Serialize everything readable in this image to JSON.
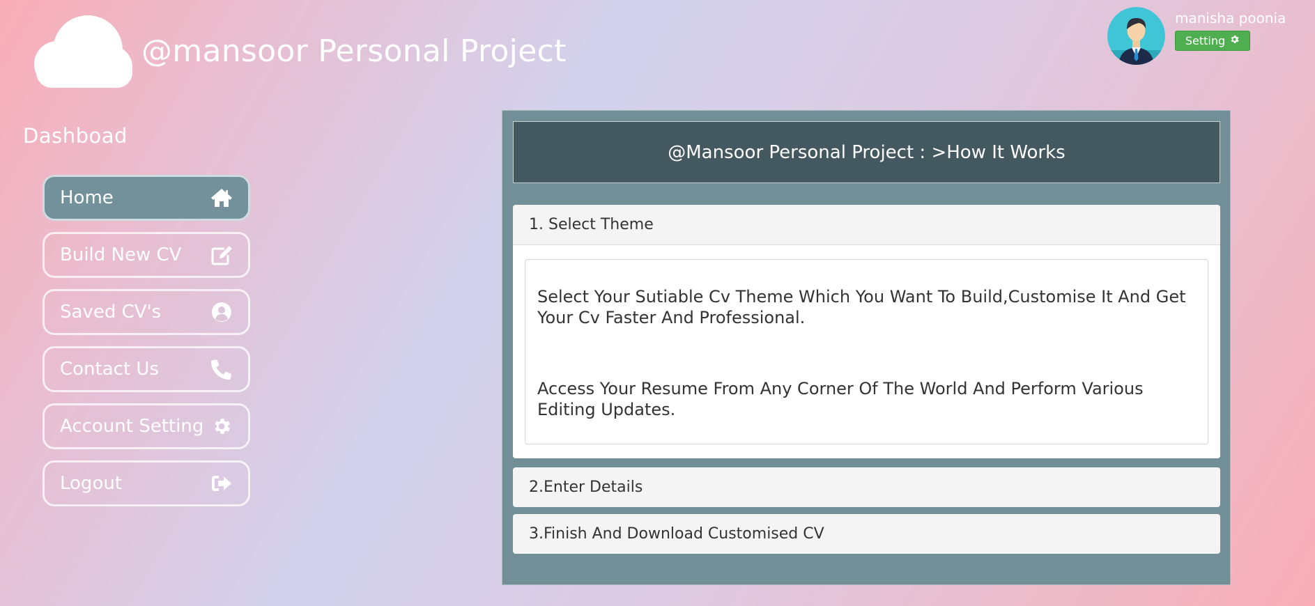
{
  "header": {
    "site_title": "@mansoor Personal Project",
    "logo_icon": "cloud-icon"
  },
  "user": {
    "name": "manisha poonia",
    "setting_label": "Setting",
    "avatar_icon": "user-avatar-icon"
  },
  "sidebar": {
    "title": "Dashboad",
    "items": [
      {
        "label": "Home",
        "icon": "home-icon",
        "active": true
      },
      {
        "label": "Build New CV",
        "icon": "edit-icon",
        "active": false
      },
      {
        "label": "Saved CV's",
        "icon": "user-circle-icon",
        "active": false
      },
      {
        "label": "Contact Us",
        "icon": "phone-icon",
        "active": false
      },
      {
        "label": "Account Setting",
        "icon": "gear-icon",
        "active": false
      },
      {
        "label": "Logout",
        "icon": "logout-icon",
        "active": false
      }
    ]
  },
  "main": {
    "header": "@Mansoor Personal Project : >How It Works",
    "steps": [
      {
        "title": "1. Select Theme",
        "expanded": true,
        "paragraphs": [
          "Select Your Sutiable Cv Theme Which You Want To Build,Customise It And Get Your Cv Faster And Professional.",
          "Access Your Resume From Any Corner Of The World And Perform Various Editing Updates."
        ]
      },
      {
        "title": "2.Enter Details",
        "expanded": false
      },
      {
        "title": "3.Finish And Download Customised CV",
        "expanded": false
      }
    ]
  },
  "colors": {
    "active_nav": "#72919a",
    "panel": "#728f98",
    "panel_header": "#445860",
    "setting_button": "#4fae4f"
  }
}
